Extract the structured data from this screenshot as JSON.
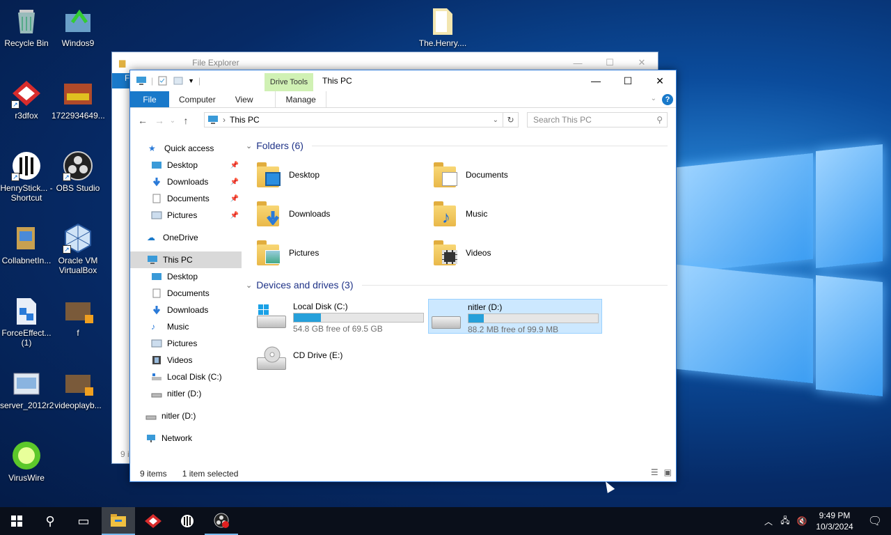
{
  "desktop": {
    "icons": [
      {
        "label": "Recycle Bin",
        "icon": "recycle-bin-icon"
      },
      {
        "label": "Windos9",
        "icon": "windos9-icon"
      },
      {
        "label": "The.Henry....",
        "icon": "document-icon"
      },
      {
        "label": "r3dfox",
        "icon": "r3dfox-icon"
      },
      {
        "label": "1722934649...",
        "icon": "image-icon"
      },
      {
        "label": "HenryStick... - Shortcut",
        "icon": "henrystick-icon"
      },
      {
        "label": "OBS Studio",
        "icon": "obs-icon"
      },
      {
        "label": "CollabnetIn...",
        "icon": "installer-icon"
      },
      {
        "label": "Oracle VM VirtualBox",
        "icon": "virtualbox-icon"
      },
      {
        "label": "ForceEffect... (1)",
        "icon": "setup-icon"
      },
      {
        "label": "f",
        "icon": "video-icon"
      },
      {
        "label": "server_2012r2",
        "icon": "server-icon"
      },
      {
        "label": "videoplayb...",
        "icon": "video-icon"
      },
      {
        "label": "VirusWire",
        "icon": "viruswire-icon"
      }
    ]
  },
  "back_window": {
    "title": "File Explorer",
    "status": "9 i",
    "ribbon_letter": "F"
  },
  "window": {
    "title": "This PC",
    "drive_tools": "Drive Tools",
    "ribbon_tabs": [
      "File",
      "Computer",
      "View",
      "Manage"
    ],
    "help": "?",
    "address": "This PC",
    "search_placeholder": "Search This PC"
  },
  "nav": {
    "quick_access": "Quick access",
    "quick_items": [
      "Desktop",
      "Downloads",
      "Documents",
      "Pictures"
    ],
    "onedrive": "OneDrive",
    "this_pc": "This PC",
    "pc_items": [
      "Desktop",
      "Documents",
      "Downloads",
      "Music",
      "Pictures",
      "Videos",
      "Local Disk (C:)",
      "nitler (D:)"
    ],
    "nitler": "nitler (D:)",
    "network": "Network"
  },
  "folders": {
    "header": "Folders (6)",
    "items": [
      "Desktop",
      "Documents",
      "Downloads",
      "Music",
      "Pictures",
      "Videos"
    ]
  },
  "devices": {
    "header": "Devices and drives (3)",
    "drives": [
      {
        "name": "Local Disk (C:)",
        "free": "54.8 GB free of 69.5 GB",
        "used_fraction": 0.21
      },
      {
        "name": "nitler (D:)",
        "free": "88.2 MB free of 99.9 MB",
        "used_fraction": 0.12
      },
      {
        "name": "CD Drive (E:)"
      }
    ]
  },
  "status": {
    "items": "9 items",
    "selected": "1 item selected"
  },
  "taskbar": {
    "time": "9:49 PM",
    "date": "10/3/2024"
  },
  "colors": {
    "accent": "#1979ca",
    "drive_tools": "#d0f1b4",
    "selection": "#cce8ff",
    "bar_fill": "#26a0da"
  }
}
